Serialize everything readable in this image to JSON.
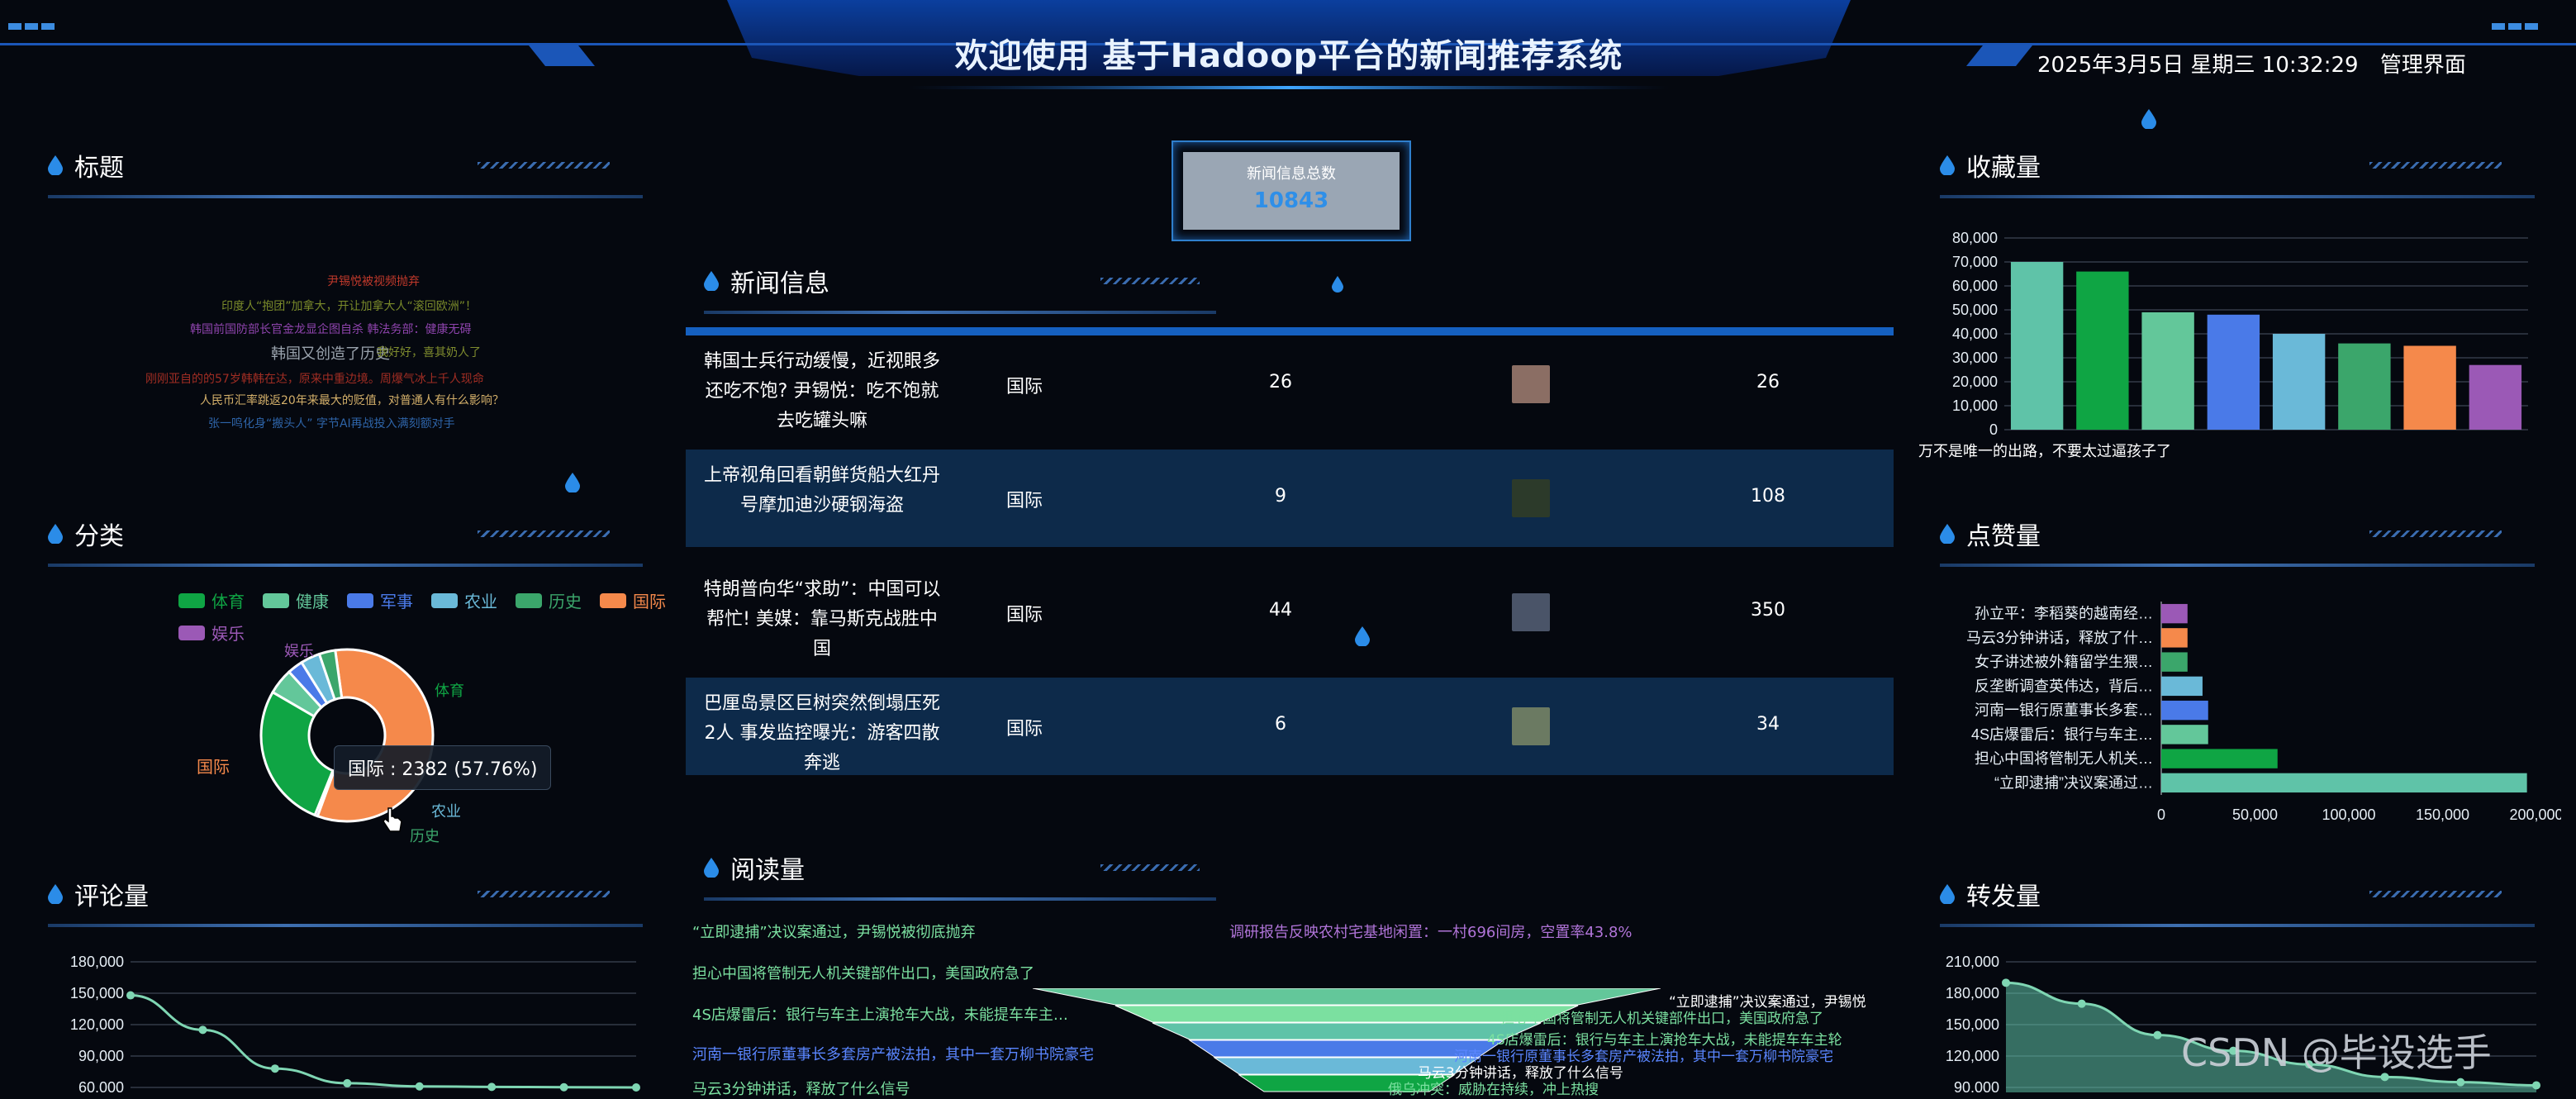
{
  "header": {
    "title": "欢迎使用 基于Hadoop平台的新闻推荐系统",
    "datetime": "2025年3月5日 星期三 10:32:29",
    "admin_link": "管理界面"
  },
  "total": {
    "label": "新闻信息总数",
    "value": "10843"
  },
  "panels": {
    "title_cloud": "标题",
    "category": "分类",
    "comments": "评论量",
    "news": "新闻信息",
    "reads": "阅读量",
    "favorites": "收藏量",
    "likes": "点赞量",
    "shares": "转发量"
  },
  "word_cloud": [
    {
      "text": "尹锡悦被视频抛弃",
      "color": "#c0392b"
    },
    {
      "text": "印度人“抱团”加拿大，开让加拿大人“滚回欧洲”！",
      "color": "#7a8a2a"
    },
    {
      "text": "韩国前国防部长官金龙显企图自杀 韩法务部：健康无碍",
      "color": "#8e44ad"
    },
    {
      "text": "韩国又创造了历史",
      "color": "#9aa3ad"
    },
    {
      "text": "我好好，喜其奶人了",
      "color": "#7f8c2e"
    },
    {
      "text": "刚刚亚自的的57岁韩韩在达，原来中重边境。周爆气冰上千人现命",
      "color": "#a02d23"
    },
    {
      "text": "人民币汇率跳返20年来最大的贬值，对普通人有什么影响？",
      "color": "#d4b06a"
    },
    {
      "text": "张一鸣化身“搬头人” 字节AI再战投入满刻额对手",
      "color": "#2e64a8"
    }
  ],
  "category": {
    "legend": [
      {
        "name": "体育",
        "color": "#0fa544"
      },
      {
        "name": "健康",
        "color": "#63c79a"
      },
      {
        "name": "军事",
        "color": "#4a7ae8"
      },
      {
        "name": "农业",
        "color": "#6ab9d8"
      },
      {
        "name": "历史",
        "color": "#3ba66b"
      },
      {
        "name": "国际",
        "color": "#f5894b"
      },
      {
        "name": "娱乐",
        "color": "#9b59b6"
      }
    ],
    "labels": {
      "sport": "体育",
      "intl": "国际",
      "ent": "娱乐",
      "agri": "农业",
      "hist": "历史"
    },
    "tooltip": "国际 : 2382 (57.76%)",
    "slices": [
      {
        "name": "国际",
        "value": 2382,
        "color": "#f5894b"
      },
      {
        "name": "娱乐",
        "value": 22,
        "color": "#9b59b6"
      },
      {
        "name": "体育",
        "value": 1125,
        "color": "#0fa544"
      },
      {
        "name": "健康",
        "value": 200,
        "color": "#63c79a"
      },
      {
        "name": "军事",
        "value": 120,
        "color": "#4a7ae8"
      },
      {
        "name": "农业",
        "value": 150,
        "color": "#6ab9d8"
      },
      {
        "name": "历史",
        "value": 125,
        "color": "#3ba66b"
      }
    ]
  },
  "news": [
    {
      "title": "韩国士兵行动缓慢，近视眼多还吃不饱? 尹锡悦：吃不饱就去吃罐头嘛",
      "category": "国际",
      "a": "26",
      "b": "26",
      "thumb": "#8b6e64"
    },
    {
      "title": "上帝视角回看朝鲜货船大红丹号摩加迪沙硬钢海盗",
      "category": "国际",
      "a": "9",
      "b": "108",
      "thumb": "#2c3a2a"
    },
    {
      "title": "特朗普向华“求助”：中国可以帮忙! 美媒：靠马斯克战胜中国",
      "category": "国际",
      "a": "44",
      "b": "350",
      "thumb": "#4a5468"
    },
    {
      "title": "巴厘岛景区巨树突然倒塌压死2人 事发监控曝光：游客四散奔逃",
      "category": "国际",
      "a": "6",
      "b": "34",
      "thumb": "#6b7a62"
    }
  ],
  "reads": {
    "left": [
      "“立即逮捕”决议案通过，尹锡悦被彻底抛弃",
      "担心中国将管制无人机关键部件出口，美国政府急了",
      "4S店爆雷后：银行与车主上演抢车大战，未能提车车主…",
      "河南一银行原董事长多套房产被法拍，其中一套万柳书院豪宅",
      "马云3分钟讲话，释放了什么信号"
    ],
    "right": [
      "调研报告反映农村宅基地闲置：一村696间房，空置率43.8%"
    ],
    "funnel_labels": [
      "“立即逮捕”决议案通过，尹锡悦",
      "担心中国将管制无人机关键部件出口，美国政府急了",
      "4S店爆雷后：银行与车主上演抢车大战，未能提车车主轮",
      "河南一银行原董事长多套房产被法拍，其中一套万柳书院豪宅",
      "马云3分钟讲话，释放了什么信号",
      "俄乌冲突：威胁在持续，冲上热搜"
    ]
  },
  "chart_data": [
    {
      "type": "bar",
      "title": "收藏量",
      "categories": [
        "",
        "",
        "",
        "",
        "",
        "",
        "",
        ""
      ],
      "values": [
        70000,
        66000,
        49000,
        48000,
        40000,
        36000,
        35000,
        27000
      ],
      "colors": [
        "#5fc3a8",
        "#0fa544",
        "#63c79a",
        "#4a7ae8",
        "#6ab9d8",
        "#3ba66b",
        "#f5894b",
        "#9b59b6"
      ],
      "yticks": [
        "80,000",
        "70,000",
        "60,000",
        "50,000",
        "40,000",
        "30,000",
        "20,000",
        "10,000",
        "0"
      ],
      "ylim": [
        0,
        80000
      ],
      "note": "万不是唯一的出路，不要太过逼孩子了"
    },
    {
      "type": "bar",
      "title": "点赞量",
      "orientation": "horizontal",
      "categories": [
        "孙立平：李稻葵的越南经…",
        "马云3分钟讲话，释放了什…",
        "女子讲述被外籍留学生猥…",
        "反垄断调查英伟达，背后…",
        "河南一银行原董事长多套…",
        "4S店爆雷后：银行与车主…",
        "担心中国将管制无人机关…",
        "“立即逮捕”决议案通过…"
      ],
      "values": [
        14000,
        14000,
        14000,
        22000,
        25000,
        25000,
        62000,
        195000
      ],
      "colors": [
        "#9b59b6",
        "#f5894b",
        "#3ba66b",
        "#6ab9d8",
        "#4a7ae8",
        "#63c79a",
        "#0fa544",
        "#5fc3a8"
      ],
      "xticks": [
        "0",
        "50,000",
        "100,000",
        "150,000",
        "200,000"
      ],
      "xlim": [
        0,
        200000
      ]
    },
    {
      "type": "area",
      "title": "评论量",
      "yticks": [
        "180,000",
        "150,000",
        "120,000",
        "90,000",
        "60,000"
      ],
      "ylim": [
        60000,
        180000
      ],
      "values": [
        148000,
        115000,
        78000,
        64000,
        61000,
        60500,
        60200,
        60000
      ]
    },
    {
      "type": "area",
      "title": "转发量",
      "yticks": [
        "210,000",
        "180,000",
        "150,000",
        "120,000",
        "90,000"
      ],
      "ylim": [
        90000,
        210000
      ],
      "values": [
        190000,
        170000,
        140000,
        125000,
        112000,
        100000,
        95000,
        92000
      ]
    }
  ],
  "watermark": "CSDN @毕设选手"
}
